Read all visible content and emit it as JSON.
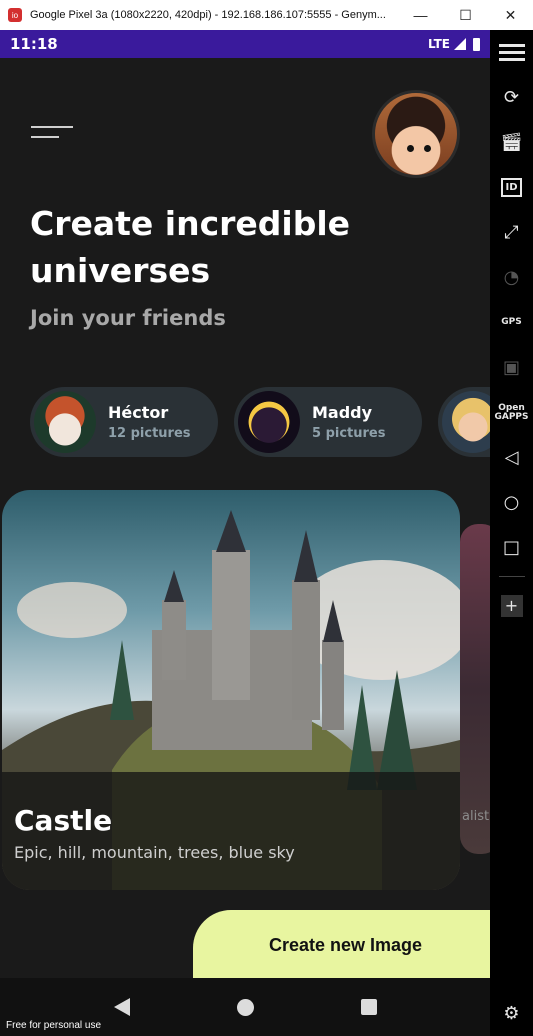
{
  "window": {
    "title": "Google Pixel 3a (1080x2220, 420dpi) - 192.168.186.107:5555 - Genym...",
    "app_icon": "genymotion-icon",
    "minimize": "—",
    "maximize": "☐",
    "close": "✕"
  },
  "statusbar": {
    "time": "11:18",
    "network": "LTE"
  },
  "header": {
    "headline": "Create incredible universes",
    "subline": "Join your friends"
  },
  "friends": [
    {
      "name": "Héctor",
      "count": "12 pictures"
    },
    {
      "name": "Maddy",
      "count": "5 pictures"
    }
  ],
  "card": {
    "title": "Castle",
    "tags": "Epic, hill, mountain, trees, blue sky"
  },
  "card_peek": {
    "text": "alist"
  },
  "create_button": {
    "label": "Create new Image"
  },
  "watermark": "Free for personal use",
  "sidebar": {
    "items": [
      "menu-icon",
      "rotate-icon",
      "clapper-icon",
      "id-icon",
      "resize-icon",
      "wifi-cast-icon",
      "gps-icon",
      "film-icon",
      "open-gapps-icon",
      "back-icon",
      "home-icon",
      "recents-icon",
      "add-icon",
      "settings-icon"
    ],
    "gps_label": "GPS",
    "gapps_label": "Open GAPPS",
    "id_label": "ID"
  },
  "colors": {
    "status_bar": "#3a1a9c",
    "background": "#1a1a1a",
    "chip": "#2a3136",
    "accent_button": "#e8f5a0"
  }
}
